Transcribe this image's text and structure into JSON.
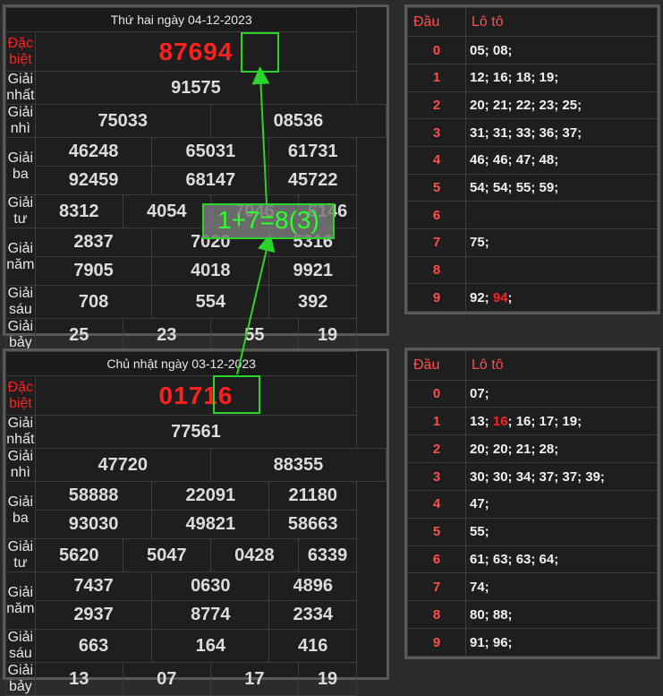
{
  "day1": {
    "header": "Thứ hai ngày 04-12-2023",
    "labels": [
      "Đặc biệt",
      "Giải nhất",
      "Giải nhì",
      "Giải ba",
      "Giải tư",
      "Giải năm",
      "Giải sáu",
      "Giải bảy"
    ],
    "special": "87694",
    "g1": "91575",
    "g2": [
      "75033",
      "08536"
    ],
    "g3": [
      "46248",
      "65031",
      "61731",
      "92459",
      "68147",
      "45722"
    ],
    "g4": [
      "8312",
      "4054",
      "7046",
      "6146"
    ],
    "g5": [
      "2837",
      "7020",
      "5316",
      "7905",
      "4018",
      "9921"
    ],
    "g6": [
      "708",
      "554",
      "392"
    ],
    "g7": [
      "25",
      "23",
      "55",
      "19"
    ]
  },
  "day2": {
    "header": "Chủ nhật ngày 03-12-2023",
    "labels": [
      "Đặc biệt",
      "Giải nhất",
      "Giải nhì",
      "Giải ba",
      "Giải tư",
      "Giải năm",
      "Giải sáu",
      "Giải bảy"
    ],
    "special": "01716",
    "g1": "77561",
    "g2": [
      "47720",
      "88355"
    ],
    "g3": [
      "58888",
      "22091",
      "21180",
      "93030",
      "49821",
      "58663"
    ],
    "g4": [
      "5620",
      "5047",
      "0428",
      "6339"
    ],
    "g5": [
      "7437",
      "0630",
      "4896",
      "2937",
      "8774",
      "2334"
    ],
    "g6": [
      "663",
      "164",
      "416"
    ],
    "g7": [
      "13",
      "07",
      "17",
      "19"
    ]
  },
  "loto1": {
    "head_dau": "Đầu",
    "head_loto": "Lô tô",
    "dau": [
      "0",
      "1",
      "2",
      "3",
      "4",
      "5",
      "6",
      "7",
      "8",
      "9"
    ],
    "lo": [
      "05; 08;",
      "12; 16; 18; 19;",
      "20; 21; 22; 23; 25;",
      "31; 31; 33; 36; 37;",
      "46; 46; 47; 48;",
      "54; 54; 55; 59;",
      "",
      "75;",
      "",
      "92; "
    ],
    "lo9_highlight": "94",
    "lo9_tail": ";"
  },
  "loto2": {
    "head_dau": "Đầu",
    "head_loto": "Lô tô",
    "dau": [
      "0",
      "1",
      "2",
      "3",
      "4",
      "5",
      "6",
      "7",
      "8",
      "9"
    ],
    "lo": [
      "07;",
      "13; ",
      "20; 20; 21; 28;",
      "30; 30; 34; 37; 37; 39;",
      "47;",
      "55;",
      "61; 63; 63; 64;",
      "74;",
      "80; 88;",
      "91; 96;"
    ],
    "lo1_highlight": "16",
    "lo1_tail": "; 16; 17; 19;"
  },
  "annotation": {
    "formula": "1+7=8(3)",
    "color": "#2bd42b"
  }
}
